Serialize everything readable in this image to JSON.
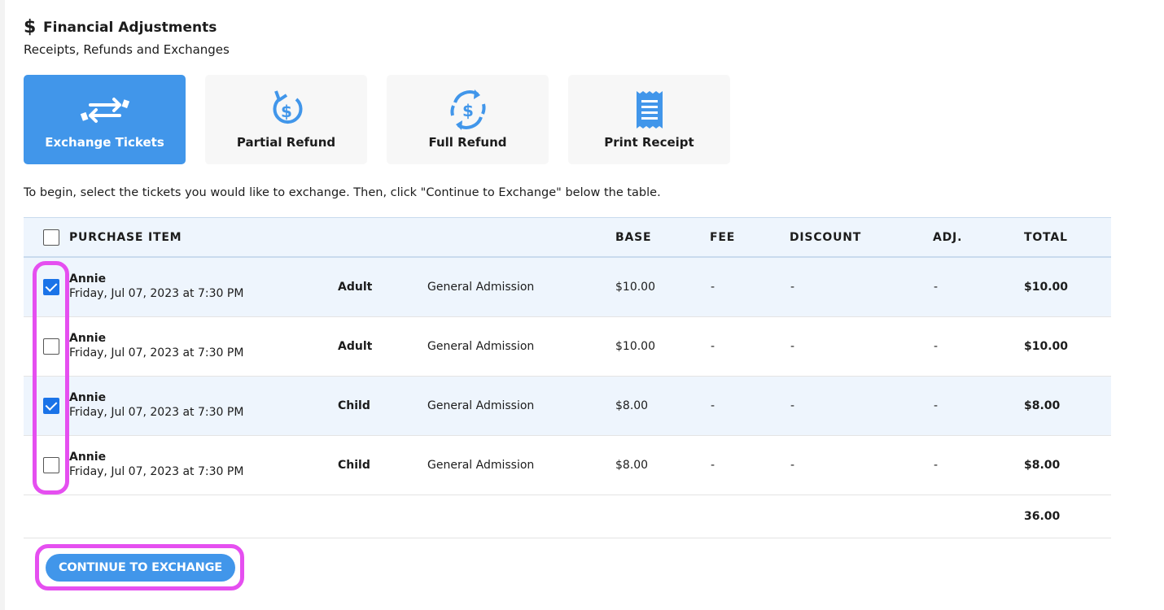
{
  "header": {
    "icon": "dollar-icon",
    "title": "Financial Adjustments",
    "subtitle": "Receipts, Refunds and Exchanges"
  },
  "actions": [
    {
      "label": "Exchange Tickets",
      "icon": "exchange-arrows-icon",
      "active": true
    },
    {
      "label": "Partial Refund",
      "icon": "partial-refund-icon",
      "active": false
    },
    {
      "label": "Full Refund",
      "icon": "full-refund-icon",
      "active": false
    },
    {
      "label": "Print Receipt",
      "icon": "receipt-icon",
      "active": false
    }
  ],
  "instruction": "To begin, select the tickets you would like to exchange. Then, click \"Continue to Exchange\" below the table.",
  "table": {
    "headers": {
      "item": "PURCHASE ITEM",
      "base": "BASE",
      "fee": "FEE",
      "discount": "DISCOUNT",
      "adj": "ADJ.",
      "total": "TOTAL"
    },
    "rows": [
      {
        "checked": true,
        "event": "Annie",
        "date": "Friday, Jul 07, 2023 at 7:30 PM",
        "type": "Adult",
        "section": "General Admission",
        "base": "$10.00",
        "fee": "-",
        "discount": "-",
        "adj": "-",
        "total": "$10.00"
      },
      {
        "checked": false,
        "event": "Annie",
        "date": "Friday, Jul 07, 2023 at 7:30 PM",
        "type": "Adult",
        "section": "General Admission",
        "base": "$10.00",
        "fee": "-",
        "discount": "-",
        "adj": "-",
        "total": "$10.00"
      },
      {
        "checked": true,
        "event": "Annie",
        "date": "Friday, Jul 07, 2023 at 7:30 PM",
        "type": "Child",
        "section": "General Admission",
        "base": "$8.00",
        "fee": "-",
        "discount": "-",
        "adj": "-",
        "total": "$8.00"
      },
      {
        "checked": false,
        "event": "Annie",
        "date": "Friday, Jul 07, 2023 at 7:30 PM",
        "type": "Child",
        "section": "General Admission",
        "base": "$8.00",
        "fee": "-",
        "discount": "-",
        "adj": "-",
        "total": "$8.00"
      }
    ],
    "grand_total": "36.00"
  },
  "continue_label": "CONTINUE TO EXCHANGE",
  "colors": {
    "accent": "#4196ea",
    "highlight": "#e54ff0",
    "row_alt": "#eef5fd"
  }
}
